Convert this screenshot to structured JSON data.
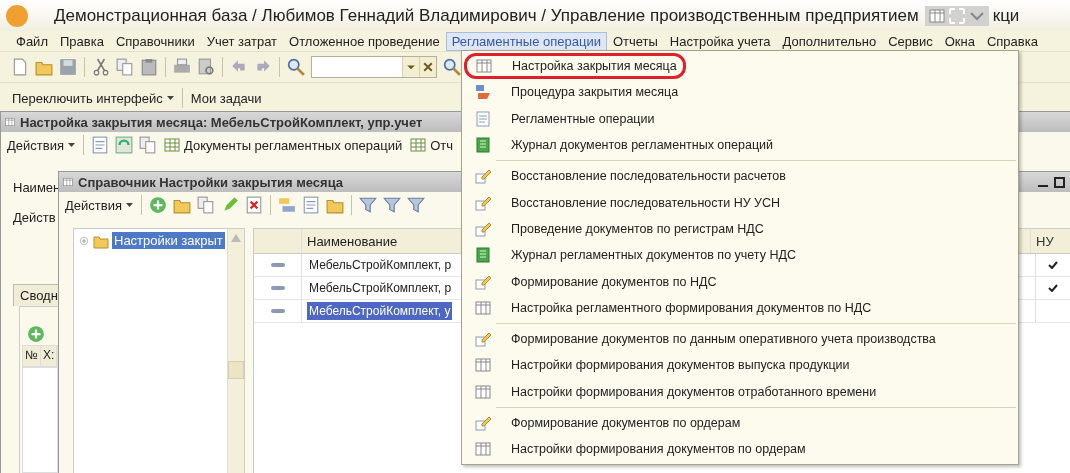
{
  "title": {
    "text": "Демонстрационная база / Любимов Геннадий Владимирович /  Управление производственным предприятием",
    "tail": "кци"
  },
  "menu_bar": [
    {
      "label": "Файл",
      "selected": false
    },
    {
      "label": "Правка",
      "selected": false
    },
    {
      "label": "Справочники",
      "selected": false
    },
    {
      "label": "Учет затрат",
      "selected": false
    },
    {
      "label": "Отложенное проведение",
      "selected": false
    },
    {
      "label": "Регламентные операции",
      "selected": true
    },
    {
      "label": "Отчеты",
      "selected": false
    },
    {
      "label": "Настройка учета",
      "selected": false
    },
    {
      "label": "Дополнительно",
      "selected": false
    },
    {
      "label": "Сервис",
      "selected": false
    },
    {
      "label": "Окна",
      "selected": false
    },
    {
      "label": "Справка",
      "selected": false
    }
  ],
  "toolbar2": {
    "switch": "Переключить интерфейс",
    "tasks": "Мои задачи"
  },
  "window_settings": {
    "title": "Настройка закрытия месяца: МебельСтройКомплект, упр.учет",
    "actions": "Действия",
    "documents_button": "Документы регламентных операций",
    "reports_button": "Отч",
    "labels": [
      "Наимен",
      "Действ"
    ],
    "tab": "Сводн",
    "columns": [
      "№",
      "Х:"
    ]
  },
  "window_catalog": {
    "title": "Справочник Настройки закрытия месяца",
    "actions": "Действия",
    "tree": [
      {
        "label": "Настройки закрыт",
        "selected": true
      }
    ],
    "columns": [
      "Наименование",
      "НУ"
    ],
    "rows": [
      {
        "name": "МебельСтройКомплект, р",
        "nu": true,
        "selected": false
      },
      {
        "name": "МебельСтройКомплект, р",
        "nu": true,
        "selected": false
      },
      {
        "name": "МебельСтройКомплект, у",
        "nu": false,
        "selected": true
      }
    ]
  },
  "dropdown": {
    "groups": [
      [
        {
          "label": "Настройка закрытия месяца",
          "kind": "grid",
          "marked": true
        },
        {
          "label": "Процедура закрытия месяца",
          "kind": "procedure",
          "marked": false
        },
        {
          "label": "Регламентные операции",
          "kind": "document",
          "marked": false
        },
        {
          "label": "Журнал документов регламентных операций",
          "kind": "journal",
          "marked": false
        }
      ],
      [
        {
          "label": "Восстановление последовательности расчетов",
          "kind": "processing",
          "marked": false
        },
        {
          "label": "Восстановление последовательности НУ УСН",
          "kind": "processing",
          "marked": false
        },
        {
          "label": "Проведение документов по регистрам НДС",
          "kind": "processing",
          "marked": false
        },
        {
          "label": "Журнал регламентных документов по учету НДС",
          "kind": "journal",
          "marked": false
        },
        {
          "label": "Формирование документов по НДС",
          "kind": "processing",
          "marked": false
        },
        {
          "label": "Настройка регламентного формирования документов по НДС",
          "kind": "grid",
          "marked": false
        }
      ],
      [
        {
          "label": "Формирование документов по данным оперативного учета производства",
          "kind": "processing",
          "marked": false
        },
        {
          "label": "Настройки формирования документов выпуска продукции",
          "kind": "grid",
          "marked": false
        },
        {
          "label": "Настройки формирования документов отработанного времени",
          "kind": "grid",
          "marked": false
        }
      ],
      [
        {
          "label": "Формирование документов по ордерам",
          "kind": "processing",
          "marked": false
        },
        {
          "label": "Настройки формирования документов по ордерам",
          "kind": "grid",
          "marked": false
        }
      ]
    ]
  }
}
